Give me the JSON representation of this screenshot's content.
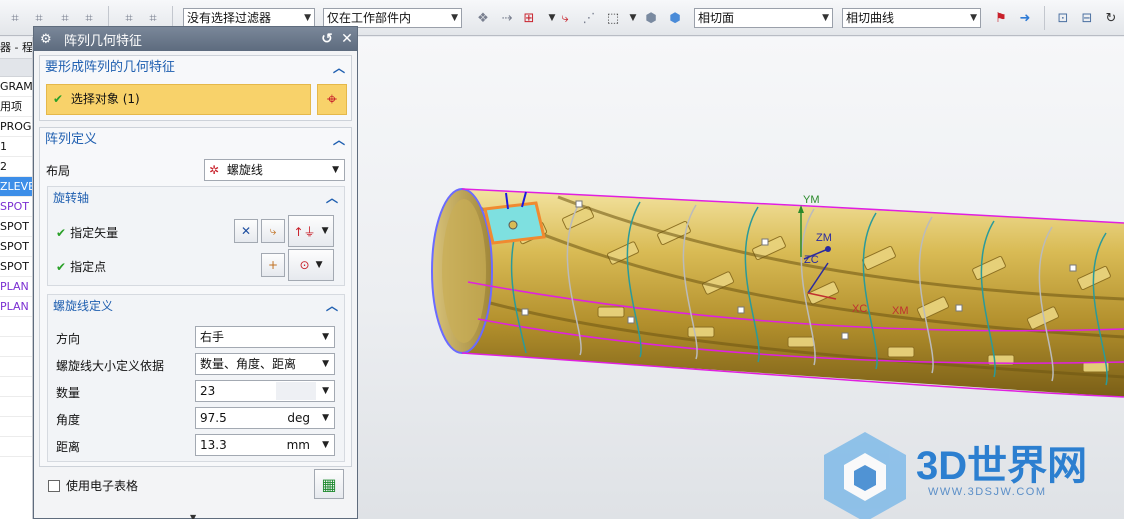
{
  "toolbar": {
    "filter_select": "没有选择过滤器",
    "scope_select": "仅在工作部件内",
    "face_rule": "相切面",
    "curve_rule": "相切曲线"
  },
  "navigator": {
    "title": "器 - 程",
    "rows": [
      {
        "text": "GRAM",
        "style": "normal"
      },
      {
        "text": "用项",
        "style": "normal"
      },
      {
        "text": "PROG",
        "style": "normal"
      },
      {
        "text": "1",
        "style": "normal"
      },
      {
        "text": "2",
        "style": "normal"
      },
      {
        "text": "ZLEVE",
        "style": "selected"
      },
      {
        "text": "SPOT",
        "style": "purple"
      },
      {
        "text": "SPOT",
        "style": "normal"
      },
      {
        "text": "SPOT",
        "style": "normal"
      },
      {
        "text": "SPOT",
        "style": "normal"
      },
      {
        "text": "PLAN",
        "style": "purple"
      },
      {
        "text": "PLAN",
        "style": "purple"
      },
      {
        "text": "",
        "style": "normal"
      },
      {
        "text": "",
        "style": "normal"
      },
      {
        "text": "",
        "style": "normal"
      },
      {
        "text": "",
        "style": "normal"
      },
      {
        "text": "",
        "style": "normal"
      },
      {
        "text": "",
        "style": "normal"
      },
      {
        "text": "",
        "style": "normal"
      }
    ]
  },
  "dialog": {
    "title": "阵列几何特征",
    "feature_group": {
      "header": "要形成阵列的几何特征",
      "select_label": "选择对象 (1)"
    },
    "pattern_group": {
      "header": "阵列定义",
      "layout_label": "布局",
      "layout_value": "螺旋线",
      "axis": {
        "header": "旋转轴",
        "vector_label": "指定矢量",
        "point_label": "指定点"
      },
      "helix": {
        "header": "螺旋线定义",
        "direction_label": "方向",
        "direction_value": "右手",
        "size_label": "螺旋线大小定义依据",
        "size_value": "数量、角度、距离",
        "count_label": "数量",
        "count_value": "23",
        "angle_label": "角度",
        "angle_value": "97.5",
        "angle_unit": "deg",
        "distance_label": "距离",
        "distance_value": "13.3",
        "distance_unit": "mm"
      }
    },
    "spreadsheet_label": "使用电子表格"
  },
  "viewport": {
    "axis_labels": {
      "ym": "YM",
      "zm": "ZM",
      "zc": "ZC",
      "xc": "XC",
      "xm": "XM"
    },
    "watermark_text": "3D世界网",
    "watermark_url": "WWW.3DSJW.COM"
  },
  "colors": {
    "accent_blue": "#1f5fb0",
    "selection_yellow": "#f8d26a",
    "check_green": "#2aa028",
    "helix_magenta": "#e020e0",
    "part_gold": "#c9a63a"
  }
}
